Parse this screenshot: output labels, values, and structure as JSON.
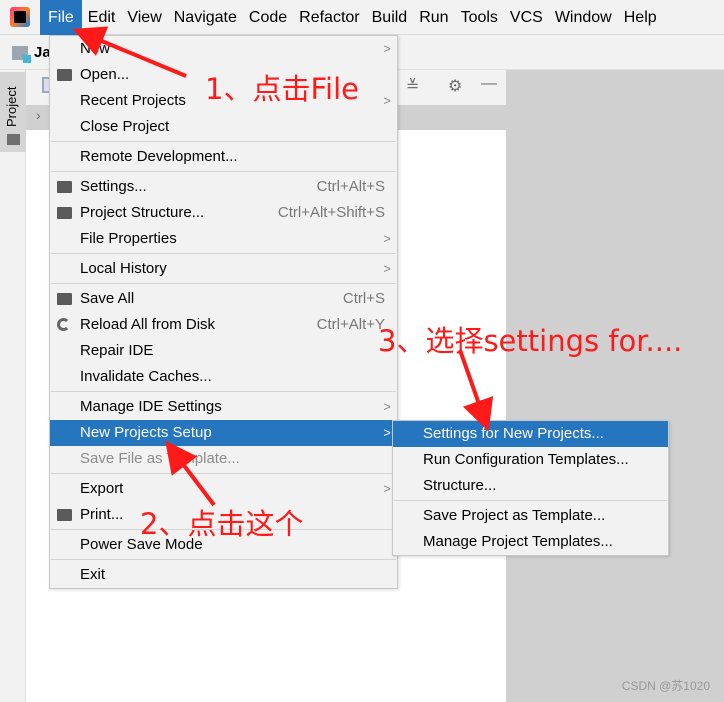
{
  "menubar": {
    "items": [
      {
        "label": "File",
        "mn": "F",
        "active": true
      },
      {
        "label": "Edit",
        "mn": "E"
      },
      {
        "label": "View",
        "mn": "V"
      },
      {
        "label": "Navigate",
        "mn": "N"
      },
      {
        "label": "Code",
        "mn": "C"
      },
      {
        "label": "Refactor",
        "mn": "R"
      },
      {
        "label": "Build",
        "mn": "B"
      },
      {
        "label": "Run",
        "mn": "u"
      },
      {
        "label": "Tools",
        "mn": "T"
      },
      {
        "label": "VCS",
        "mn": "S"
      },
      {
        "label": "Window",
        "mn": "W"
      },
      {
        "label": "Help",
        "mn": "H"
      }
    ]
  },
  "breadcrumb": {
    "project": "Ja"
  },
  "sidebar": {
    "tab_label": "Project"
  },
  "file_menu": [
    {
      "label": "New",
      "mn": "N",
      "submenu": true
    },
    {
      "label": "Open...",
      "mn": "O",
      "icon": "folder-open-icon"
    },
    {
      "label": "Recent Projects",
      "mn": "R",
      "submenu": true
    },
    {
      "label": "Close Project"
    },
    {
      "sep": true
    },
    {
      "label": "Remote Development..."
    },
    {
      "sep": true
    },
    {
      "label": "Settings...",
      "mn": "t",
      "icon": "wrench-icon",
      "shortcut": "Ctrl+Alt+S"
    },
    {
      "label": "Project Structure...",
      "icon": "project-structure-icon",
      "shortcut": "Ctrl+Alt+Shift+S"
    },
    {
      "label": "File Properties",
      "submenu": true
    },
    {
      "sep": true
    },
    {
      "label": "Local History",
      "mn": "H",
      "submenu": true
    },
    {
      "sep": true
    },
    {
      "label": "Save All",
      "mn": "S",
      "icon": "save-icon",
      "shortcut": "Ctrl+S"
    },
    {
      "label": "Reload All from Disk",
      "icon": "reload-icon",
      "shortcut": "Ctrl+Alt+Y"
    },
    {
      "label": "Repair IDE"
    },
    {
      "label": "Invalidate Caches..."
    },
    {
      "sep": true
    },
    {
      "label": "Manage IDE Settings",
      "submenu": true
    },
    {
      "label": "New Projects Setup",
      "submenu": true,
      "selected": true
    },
    {
      "label": "Save File as Template...",
      "disabled": true
    },
    {
      "sep": true
    },
    {
      "label": "Export",
      "submenu": true
    },
    {
      "label": "Print...",
      "mn": "P",
      "icon": "print-icon"
    },
    {
      "sep": true
    },
    {
      "label": "Power Save Mode"
    },
    {
      "sep": true
    },
    {
      "label": "Exit",
      "mn": "x"
    }
  ],
  "submenu": [
    {
      "label": "Settings for New Projects...",
      "selected": true
    },
    {
      "label": "Run Configuration Templates..."
    },
    {
      "label": "Structure..."
    },
    {
      "sep": true
    },
    {
      "label": "Save Project as Template..."
    },
    {
      "label": "Manage Project Templates..."
    }
  ],
  "annotations": {
    "step1": "1、点击File",
    "step2": "2、点击这个",
    "step3": "3、选择settings for....",
    "color": "#ff1a1a"
  },
  "watermark": "CSDN @苏1020",
  "colors": {
    "accent": "#2675bf",
    "background": "#f2f2f2"
  }
}
